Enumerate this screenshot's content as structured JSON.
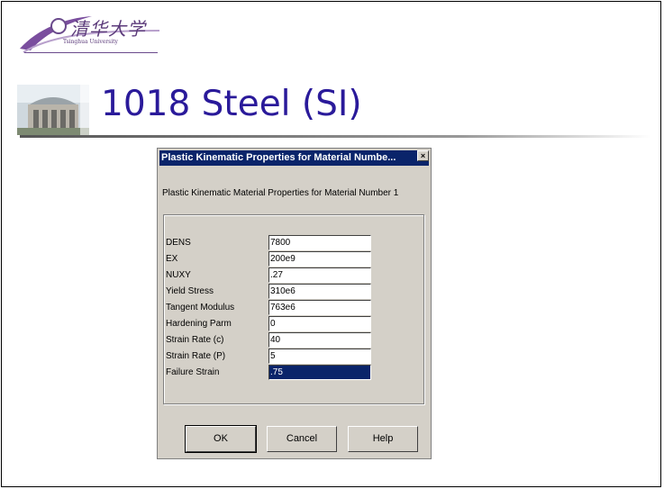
{
  "slide": {
    "title": "1018 Steel (SI)",
    "logo": {
      "text": "清华大学",
      "subtext": "Tsinghua University"
    }
  },
  "dialog": {
    "title": "Plastic Kinematic Properties for Material Numbe...",
    "close_glyph": "×",
    "subtitle": "Plastic Kinematic Material Properties for Material Number 1",
    "fields": [
      {
        "label": "DENS",
        "value": "7800"
      },
      {
        "label": "EX",
        "value": "200e9"
      },
      {
        "label": "NUXY",
        "value": ".27"
      },
      {
        "label": "Yield Stress",
        "value": "310e6"
      },
      {
        "label": "Tangent Modulus",
        "value": "763e6"
      },
      {
        "label": "Hardening Parm",
        "value": "0"
      },
      {
        "label": "Strain Rate (c)",
        "value": "40"
      },
      {
        "label": "Strain Rate (P)",
        "value": "5"
      },
      {
        "label": "Failure Strain",
        "value": ".75"
      }
    ],
    "buttons": {
      "ok": "OK",
      "cancel": "Cancel",
      "help": "Help"
    }
  }
}
